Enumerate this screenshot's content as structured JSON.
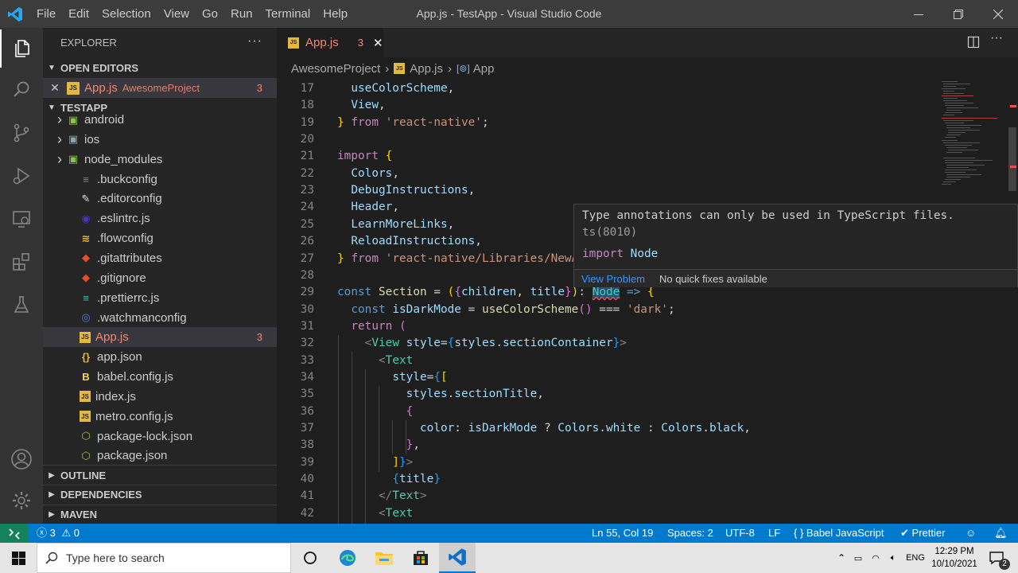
{
  "window": {
    "title": "App.js - TestApp - Visual Studio Code",
    "menu": [
      "File",
      "Edit",
      "Selection",
      "View",
      "Go",
      "Run",
      "Terminal",
      "Help"
    ]
  },
  "sidebar": {
    "header": "EXPLORER",
    "open_editors": {
      "title": "OPEN EDITORS",
      "items": [
        {
          "name": "App.js",
          "folder": "AwesomeProject",
          "problems": "3"
        }
      ]
    },
    "project": {
      "title": "TESTAPP",
      "items": [
        {
          "name": "android",
          "icon": "android-folder-icon"
        },
        {
          "name": "ios",
          "icon": "ios-folder-icon"
        },
        {
          "name": "node_modules",
          "icon": "node-folder-icon"
        },
        {
          "name": ".buckconfig",
          "icon": "config-file-icon"
        },
        {
          "name": ".editorconfig",
          "icon": "editorconfig-file-icon"
        },
        {
          "name": ".eslintrc.js",
          "icon": "eslint-file-icon"
        },
        {
          "name": ".flowconfig",
          "icon": "flow-file-icon"
        },
        {
          "name": ".gitattributes",
          "icon": "git-file-icon"
        },
        {
          "name": ".gitignore",
          "icon": "git-file-icon"
        },
        {
          "name": ".prettierrc.js",
          "icon": "prettier-file-icon"
        },
        {
          "name": ".watchmanconfig",
          "icon": "watchman-file-icon"
        },
        {
          "name": "App.js",
          "icon": "js-file-icon",
          "problems": "3"
        },
        {
          "name": "app.json",
          "icon": "json-file-icon"
        },
        {
          "name": "babel.config.js",
          "icon": "babel-file-icon"
        },
        {
          "name": "index.js",
          "icon": "js-file-icon"
        },
        {
          "name": "metro.config.js",
          "icon": "js-file-icon"
        },
        {
          "name": "package-lock.json",
          "icon": "npm-file-icon"
        },
        {
          "name": "package.json",
          "icon": "npm-file-icon"
        }
      ]
    },
    "sections": [
      "OUTLINE",
      "DEPENDENCIES",
      "MAVEN"
    ]
  },
  "editor": {
    "tab": {
      "name": "App.js",
      "problems": "3"
    },
    "breadcrumb": [
      "AwesomeProject",
      "App.js",
      "App"
    ],
    "lines": [
      {
        "n": "17",
        "html": "  <span class=\"vr\">useColorScheme</span><span class=\"pn\">,</span>"
      },
      {
        "n": "18",
        "html": "  <span class=\"vr\">View</span><span class=\"pn\">,</span>"
      },
      {
        "n": "19",
        "html": "<span class=\"br\">}</span> <span class=\"kp\">from</span> <span class=\"str\">'react-native'</span><span class=\"pn\">;</span>"
      },
      {
        "n": "20",
        "html": ""
      },
      {
        "n": "21",
        "html": "<span class=\"kp\">import</span> <span class=\"br\">{</span>"
      },
      {
        "n": "22",
        "html": "  <span class=\"vr\">Colors</span><span class=\"pn\">,</span>"
      },
      {
        "n": "23",
        "html": "  <span class=\"vr\">DebugInstructions</span><span class=\"pn\">,</span>"
      },
      {
        "n": "24",
        "html": "  <span class=\"vr\">Header</span><span class=\"pn\">,</span>"
      },
      {
        "n": "25",
        "html": "  <span class=\"vr\">LearnMoreLinks</span><span class=\"pn\">,</span>"
      },
      {
        "n": "26",
        "html": "  <span class=\"vr\">ReloadInstructions</span><span class=\"pn\">,</span>"
      },
      {
        "n": "27",
        "html": "<span class=\"br\">}</span> <span class=\"kp\">from</span> <span class=\"str\">'react-native/Libraries/NewAppScreen'</span><span class=\"pn\">;</span>"
      },
      {
        "n": "28",
        "html": ""
      },
      {
        "n": "29",
        "html": "<span class=\"kw\">const</span> <span class=\"fn\">Section</span> <span class=\"pn\">=</span> <span class=\"br\">(</span><span class=\"bp\">{</span><span class=\"vr\">children</span><span class=\"pn\">,</span> <span class=\"vr\">title</span><span class=\"bp\">}</span><span class=\"br\">)</span><span class=\"pn\">:</span> <span class=\"ty\" style=\"background:#264f78;text-decoration:underline wavy #f14c4c;\">Node</span> <span class=\"kw\">=&gt;</span> <span class=\"br\">{</span>"
      },
      {
        "n": "30",
        "html": "  <span class=\"kw\">const</span> <span class=\"vr\">isDarkMode</span> <span class=\"pn\">=</span> <span class=\"fn\">useColorScheme</span><span class=\"bp\">()</span> <span class=\"pn\">===</span> <span class=\"str\">'dark'</span><span class=\"pn\">;</span>"
      },
      {
        "n": "31",
        "html": "  <span class=\"kp\">return</span> <span class=\"bp\">(</span>"
      },
      {
        "n": "32",
        "html": "    <span class=\"tg\">&lt;</span><span class=\"ty\">View</span> <span class=\"vr\">style</span><span class=\"pn\">=</span><span class=\"bb\">{</span><span class=\"vr\">styles</span><span class=\"pn\">.</span><span class=\"vr\">sectionContainer</span><span class=\"bb\">}</span><span class=\"tg\">&gt;</span>"
      },
      {
        "n": "33",
        "html": "      <span class=\"tg\">&lt;</span><span class=\"ty\">Text</span>"
      },
      {
        "n": "34",
        "html": "        <span class=\"vr\">style</span><span class=\"pn\">=</span><span class=\"bb\">{</span><span class=\"br\">[</span>"
      },
      {
        "n": "35",
        "html": "          <span class=\"vr\">styles</span><span class=\"pn\">.</span><span class=\"vr\">sectionTitle</span><span class=\"pn\">,</span>"
      },
      {
        "n": "36",
        "html": "          <span class=\"bp\">{</span>"
      },
      {
        "n": "37",
        "html": "            <span class=\"vr\">color</span><span class=\"pn\">:</span> <span class=\"vr\">isDarkMode</span> <span class=\"pn\">?</span> <span class=\"vr\">Colors</span><span class=\"pn\">.</span><span class=\"vr\">white</span> <span class=\"pn\">:</span> <span class=\"vr\">Colors</span><span class=\"pn\">.</span><span class=\"vr\">black</span><span class=\"pn\">,</span>"
      },
      {
        "n": "38",
        "html": "          <span class=\"bp\">}</span><span class=\"pn\">,</span>"
      },
      {
        "n": "39",
        "html": "        <span class=\"br\">]</span><span class=\"bb\">}</span><span class=\"tg\">&gt;</span>"
      },
      {
        "n": "40",
        "html": "        <span class=\"bb\">{</span><span class=\"vr\">title</span><span class=\"bb\">}</span>"
      },
      {
        "n": "41",
        "html": "      <span class=\"tg\">&lt;/</span><span class=\"ty\">Text</span><span class=\"tg\">&gt;</span>"
      },
      {
        "n": "42",
        "html": "      <span class=\"tg\">&lt;</span><span class=\"ty\">Text</span>"
      }
    ]
  },
  "hover": {
    "message": "Type annotations can only be used in TypeScript files.",
    "code": "ts(8010)",
    "keyword": "import",
    "symbol": "Node",
    "view_problem": "View Problem",
    "no_fixes": "No quick fixes available"
  },
  "status": {
    "errors": "3",
    "warnings": "0",
    "position": "Ln 55, Col 19",
    "spaces": "Spaces: 2",
    "encoding": "UTF-8",
    "eol": "LF",
    "language": "Babel JavaScript",
    "formatter": "Prettier"
  },
  "taskbar": {
    "search_placeholder": "Type here to search",
    "language": "ENG",
    "time": "12:29 PM",
    "date": "10/10/2021",
    "notifications": "2"
  },
  "colors": {
    "accent": "#007acc",
    "error": "#f48771",
    "link": "#3794ff"
  }
}
